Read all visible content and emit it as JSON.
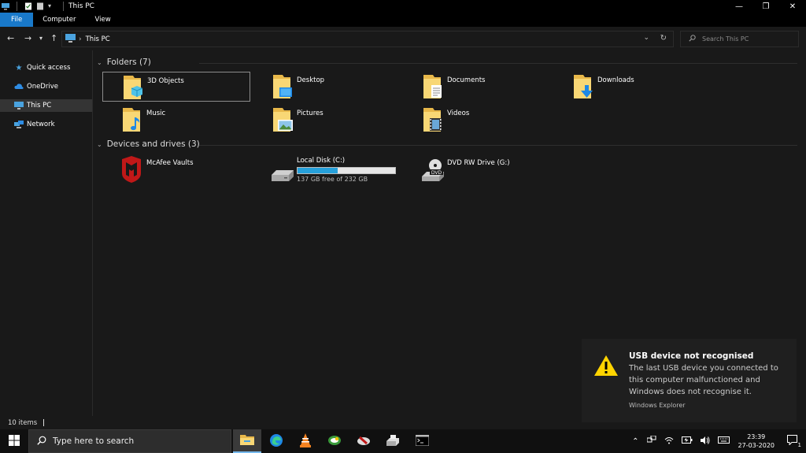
{
  "window": {
    "title": "This PC",
    "controls": {
      "minimize": "—",
      "restore": "❐",
      "close": "✕"
    }
  },
  "ribbon": {
    "tabs": [
      "File",
      "Computer",
      "View"
    ]
  },
  "address": {
    "path": "This PC",
    "search_placeholder": "Search This PC"
  },
  "nav": {
    "items": [
      {
        "label": "Quick access",
        "icon": "star-icon"
      },
      {
        "label": "OneDrive",
        "icon": "cloud-icon"
      },
      {
        "label": "This PC",
        "icon": "computer-icon"
      },
      {
        "label": "Network",
        "icon": "network-icon"
      }
    ]
  },
  "folders": {
    "header": "Folders (7)",
    "items": [
      {
        "label": "3D Objects",
        "icon": "3d-objects-folder-icon"
      },
      {
        "label": "Desktop",
        "icon": "desktop-folder-icon"
      },
      {
        "label": "Documents",
        "icon": "documents-folder-icon"
      },
      {
        "label": "Downloads",
        "icon": "downloads-folder-icon"
      },
      {
        "label": "Music",
        "icon": "music-folder-icon"
      },
      {
        "label": "Pictures",
        "icon": "pictures-folder-icon"
      },
      {
        "label": "Videos",
        "icon": "videos-folder-icon"
      }
    ]
  },
  "devices": {
    "header": "Devices and drives (3)",
    "mcafee": {
      "label": "McAfee Vaults"
    },
    "local_disk": {
      "label": "Local Disk (C:)",
      "free_text": "137 GB free of 232 GB",
      "used_fraction": 0.41
    },
    "dvd": {
      "label": "DVD RW Drive (G:)",
      "badge": "DVD"
    }
  },
  "status": {
    "items_count": "10 items"
  },
  "toast": {
    "title": "USB device not recognised",
    "body": "The last USB device you connected to this computer malfunctioned and Windows does not recognise it.",
    "source": "Windows Explorer"
  },
  "taskbar": {
    "search_placeholder": "Type here to search",
    "time": "23:39",
    "date": "27-03-2020",
    "notification_count": "1"
  },
  "colors": {
    "file_tab": "#1979ca",
    "folder_yellow": "#f8d775",
    "drive_bar": "#26a0da",
    "warning_yellow": "#ffd400"
  }
}
